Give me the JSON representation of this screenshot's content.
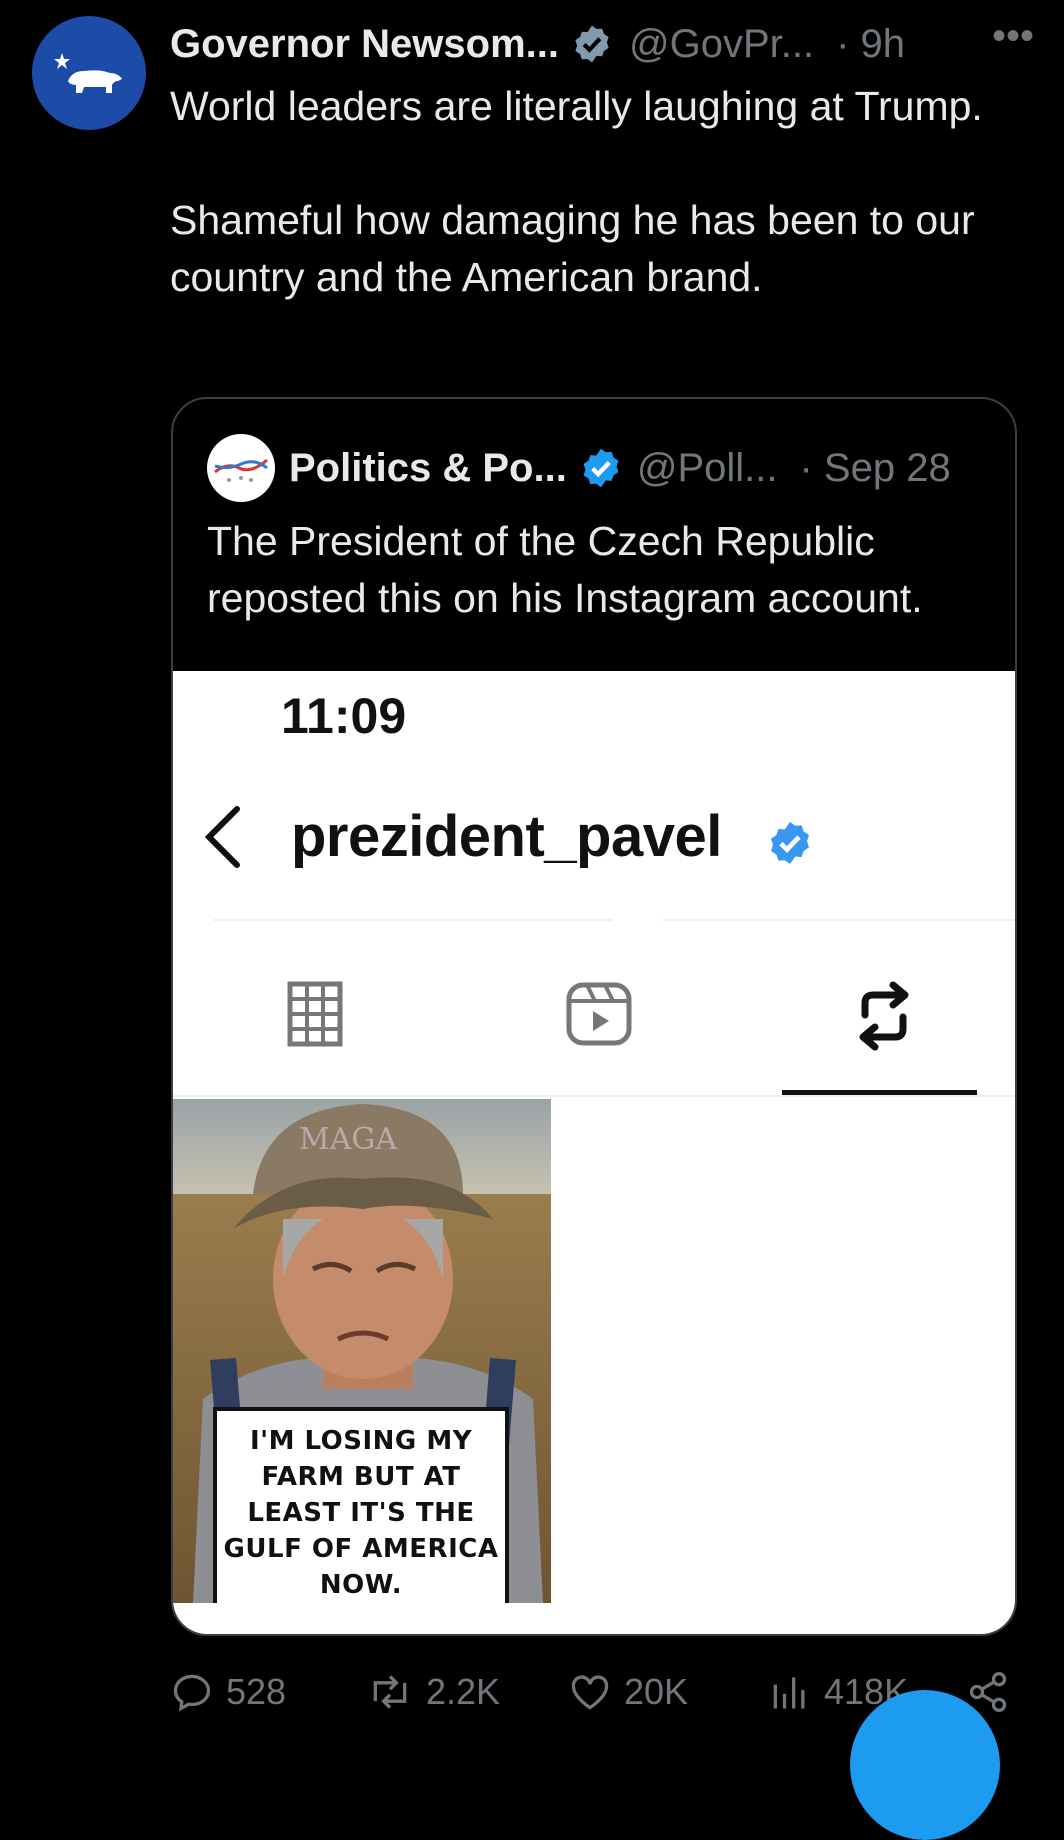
{
  "tweet": {
    "author_name": "Governor Newsom...",
    "handle": "@GovPr...",
    "time": "· 9h",
    "more": "•••",
    "text_line1": "World leaders are literally laughing at Trump.",
    "text_line2": "Shameful how damaging he has been to our country and the American brand."
  },
  "quoted": {
    "author_name": "Politics & Po...",
    "handle": "@Poll...",
    "time": "· Sep 28",
    "text": "The President of the Czech Republic reposted this on his Instagram account."
  },
  "instagram": {
    "clock": "11:09",
    "username": "prezident_pavel",
    "tabs": [
      "grid-icon",
      "reels-icon",
      "reposts-icon"
    ],
    "active_tab": "reposts",
    "post": {
      "hat_text": "MAGA",
      "caption": "I'M LOSING MY FARM BUT AT LEAST IT'S THE GULF OF AMERICA NOW."
    }
  },
  "actions": {
    "replies": "528",
    "reposts": "2.2K",
    "likes": "20K",
    "views": "418K"
  },
  "colors": {
    "background": "#000000",
    "text": "#e7e9ea",
    "muted": "#71767b",
    "verified_blue": "#1d9bf0",
    "avatar_blue": "#1d4ba8"
  }
}
